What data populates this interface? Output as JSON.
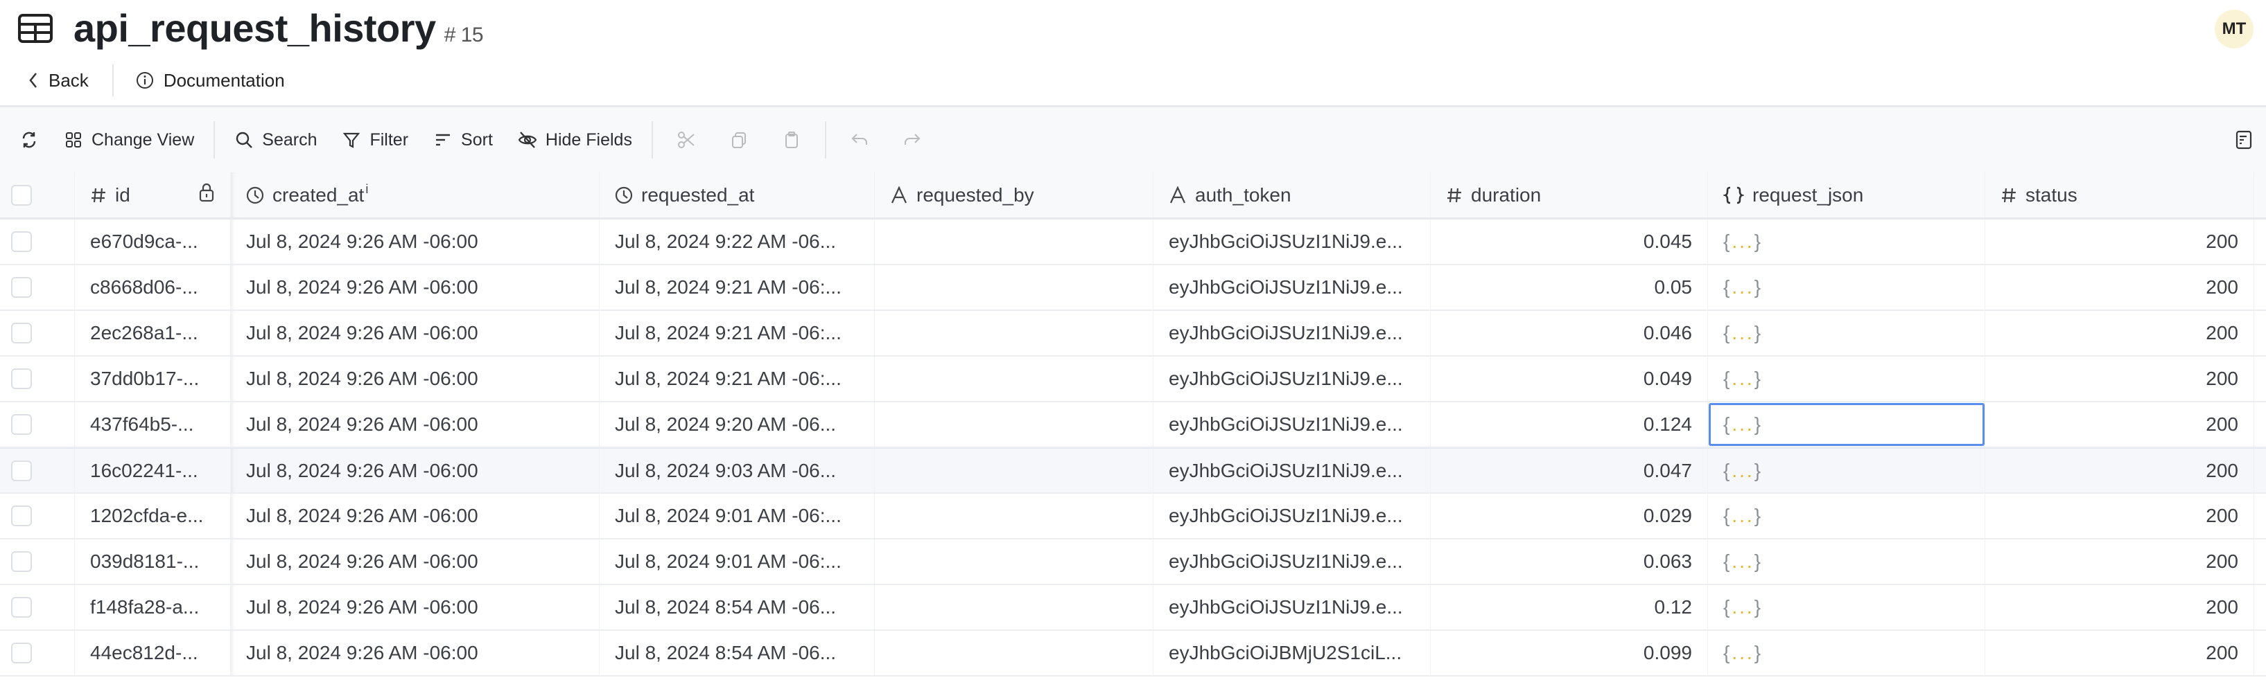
{
  "header": {
    "title": "api_request_history",
    "table_number": "# 15",
    "avatar_initials": "MT"
  },
  "nav": {
    "back": "Back",
    "documentation": "Documentation"
  },
  "toolbar": {
    "change_view": "Change View",
    "search": "Search",
    "filter": "Filter",
    "sort": "Sort",
    "hide_fields": "Hide Fields"
  },
  "columns": [
    {
      "name": "id",
      "icon": "hash"
    },
    {
      "name": "created_at",
      "icon": "clock",
      "superscript": "i"
    },
    {
      "name": "requested_at",
      "icon": "clock"
    },
    {
      "name": "requested_by",
      "icon": "text"
    },
    {
      "name": "auth_token",
      "icon": "text"
    },
    {
      "name": "duration",
      "icon": "hash"
    },
    {
      "name": "request_json",
      "icon": "braces"
    },
    {
      "name": "status",
      "icon": "hash"
    }
  ],
  "rows": [
    {
      "id": "e670d9ca-...",
      "created_at": "Jul 8, 2024 9:26 AM -06:00",
      "requested_at": "Jul 8, 2024 9:22 AM -06...",
      "requested_by": "",
      "auth_token": "eyJhbGciOiJSUzI1NiJ9.e...",
      "duration": "0.045",
      "request_json": "{...}",
      "status": "200"
    },
    {
      "id": "c8668d06-...",
      "created_at": "Jul 8, 2024 9:26 AM -06:00",
      "requested_at": "Jul 8, 2024 9:21 AM -06:...",
      "requested_by": "",
      "auth_token": "eyJhbGciOiJSUzI1NiJ9.e...",
      "duration": "0.05",
      "request_json": "{...}",
      "status": "200"
    },
    {
      "id": "2ec268a1-...",
      "created_at": "Jul 8, 2024 9:26 AM -06:00",
      "requested_at": "Jul 8, 2024 9:21 AM -06:...",
      "requested_by": "",
      "auth_token": "eyJhbGciOiJSUzI1NiJ9.e...",
      "duration": "0.046",
      "request_json": "{...}",
      "status": "200"
    },
    {
      "id": "37dd0b17-...",
      "created_at": "Jul 8, 2024 9:26 AM -06:00",
      "requested_at": "Jul 8, 2024 9:21 AM -06:...",
      "requested_by": "",
      "auth_token": "eyJhbGciOiJSUzI1NiJ9.e...",
      "duration": "0.049",
      "request_json": "{...}",
      "status": "200"
    },
    {
      "id": "437f64b5-...",
      "created_at": "Jul 8, 2024 9:26 AM -06:00",
      "requested_at": "Jul 8, 2024 9:20 AM -06...",
      "requested_by": "",
      "auth_token": "eyJhbGciOiJSUzI1NiJ9.e...",
      "duration": "0.124",
      "request_json": "{...}",
      "status": "200",
      "selected_cell": "request_json"
    },
    {
      "id": "16c02241-...",
      "created_at": "Jul 8, 2024 9:26 AM -06:00",
      "requested_at": "Jul 8, 2024 9:03 AM -06...",
      "requested_by": "",
      "auth_token": "eyJhbGciOiJSUzI1NiJ9.e...",
      "duration": "0.047",
      "request_json": "{...}",
      "status": "200",
      "hovered": true
    },
    {
      "id": "1202cfda-e...",
      "created_at": "Jul 8, 2024 9:26 AM -06:00",
      "requested_at": "Jul 8, 2024 9:01 AM -06:...",
      "requested_by": "",
      "auth_token": "eyJhbGciOiJSUzI1NiJ9.e...",
      "duration": "0.029",
      "request_json": "{...}",
      "status": "200"
    },
    {
      "id": "039d8181-...",
      "created_at": "Jul 8, 2024 9:26 AM -06:00",
      "requested_at": "Jul 8, 2024 9:01 AM -06:...",
      "requested_by": "",
      "auth_token": "eyJhbGciOiJSUzI1NiJ9.e...",
      "duration": "0.063",
      "request_json": "{...}",
      "status": "200"
    },
    {
      "id": "f148fa28-a...",
      "created_at": "Jul 8, 2024 9:26 AM -06:00",
      "requested_at": "Jul 8, 2024 8:54 AM -06...",
      "requested_by": "",
      "auth_token": "eyJhbGciOiJSUzI1NiJ9.e...",
      "duration": "0.12",
      "request_json": "{...}",
      "status": "200"
    },
    {
      "id": "44ec812d-...",
      "created_at": "Jul 8, 2024 9:26 AM -06:00",
      "requested_at": "Jul 8, 2024 8:54 AM -06...",
      "requested_by": "",
      "auth_token": "eyJhbGciOiJBMjU2S1ciL...",
      "duration": "0.099",
      "request_json": "{...}",
      "status": "200"
    }
  ],
  "colors": {
    "selection": "#5b8def",
    "json_dots": "#e3b52b",
    "avatar_bg": "#fbf3d6"
  }
}
